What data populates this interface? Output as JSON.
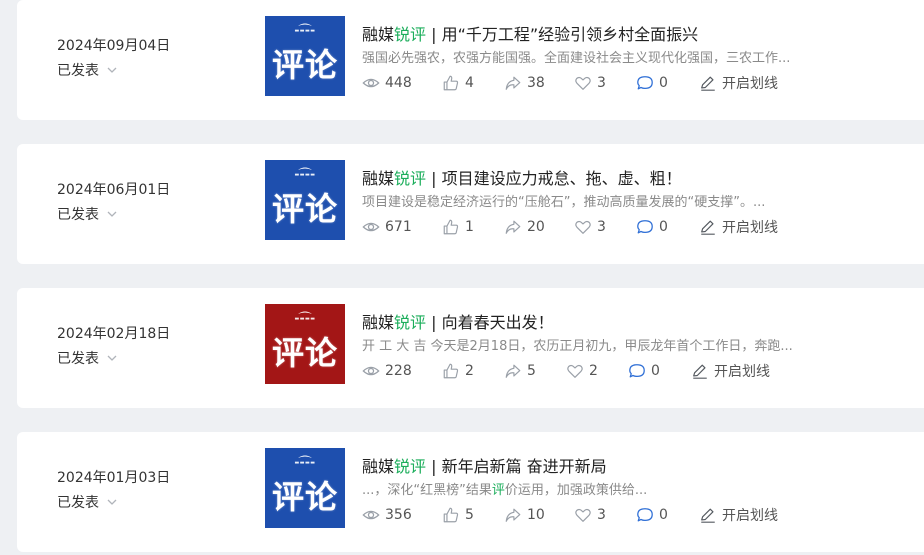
{
  "articles": [
    {
      "date": "2024年09月04日",
      "status": "已发表",
      "thumb_color": "#1e4fae",
      "thumb_text": "评论",
      "title_prefix": "融媒",
      "title_highlight": "锐评",
      "title_rest": " | 用“千万工程”经验引领乡村全面振兴",
      "desc_pre": "强国必先强农，农强方能国强。全面建设社会主义现代化强国，三农工作...",
      "desc_hl": "",
      "desc_post": "",
      "views": "448",
      "likes": "4",
      "shares": "38",
      "favorites": "3",
      "comments": "0",
      "mark_label": "开启划线"
    },
    {
      "date": "2024年06月01日",
      "status": "已发表",
      "thumb_color": "#1e4fae",
      "thumb_text": "评论",
      "title_prefix": "融媒",
      "title_highlight": "锐评",
      "title_rest": " | 项目建设应力戒怠、拖、虚、粗！",
      "desc_pre": "项目建设是稳定经济运行的“压舱石”，推动高质量发展的“硬支撑”。...",
      "desc_hl": "",
      "desc_post": "",
      "views": "671",
      "likes": "1",
      "shares": "20",
      "favorites": "3",
      "comments": "0",
      "mark_label": "开启划线"
    },
    {
      "date": "2024年02月18日",
      "status": "已发表",
      "thumb_color": "#a31616",
      "thumb_text": "评论",
      "title_prefix": "融媒",
      "title_highlight": "锐评",
      "title_rest": " | 向着春天出发！",
      "desc_pre": "开 工 大 吉 今天是2月18日，农历正月初九，甲辰龙年首个工作日，奔跑...",
      "desc_hl": "",
      "desc_post": "",
      "views": "228",
      "likes": "2",
      "shares": "5",
      "favorites": "2",
      "comments": "0",
      "mark_label": "开启划线"
    },
    {
      "date": "2024年01月03日",
      "status": "已发表",
      "thumb_color": "#1e4fae",
      "thumb_text": "评论",
      "title_prefix": "融媒",
      "title_highlight": "锐评",
      "title_rest": " | 新年启新篇 奋进开新局",
      "desc_pre": "...，深化“红黑榜”结果",
      "desc_hl": "评",
      "desc_post": "价运用，加强政策供给...",
      "views": "356",
      "likes": "5",
      "shares": "10",
      "favorites": "3",
      "comments": "0",
      "mark_label": "开启划线"
    }
  ],
  "colors": {
    "accent_green": "#1aad5a",
    "icon_gray": "#9aa0a8",
    "comment_blue": "#2f6fd6"
  }
}
